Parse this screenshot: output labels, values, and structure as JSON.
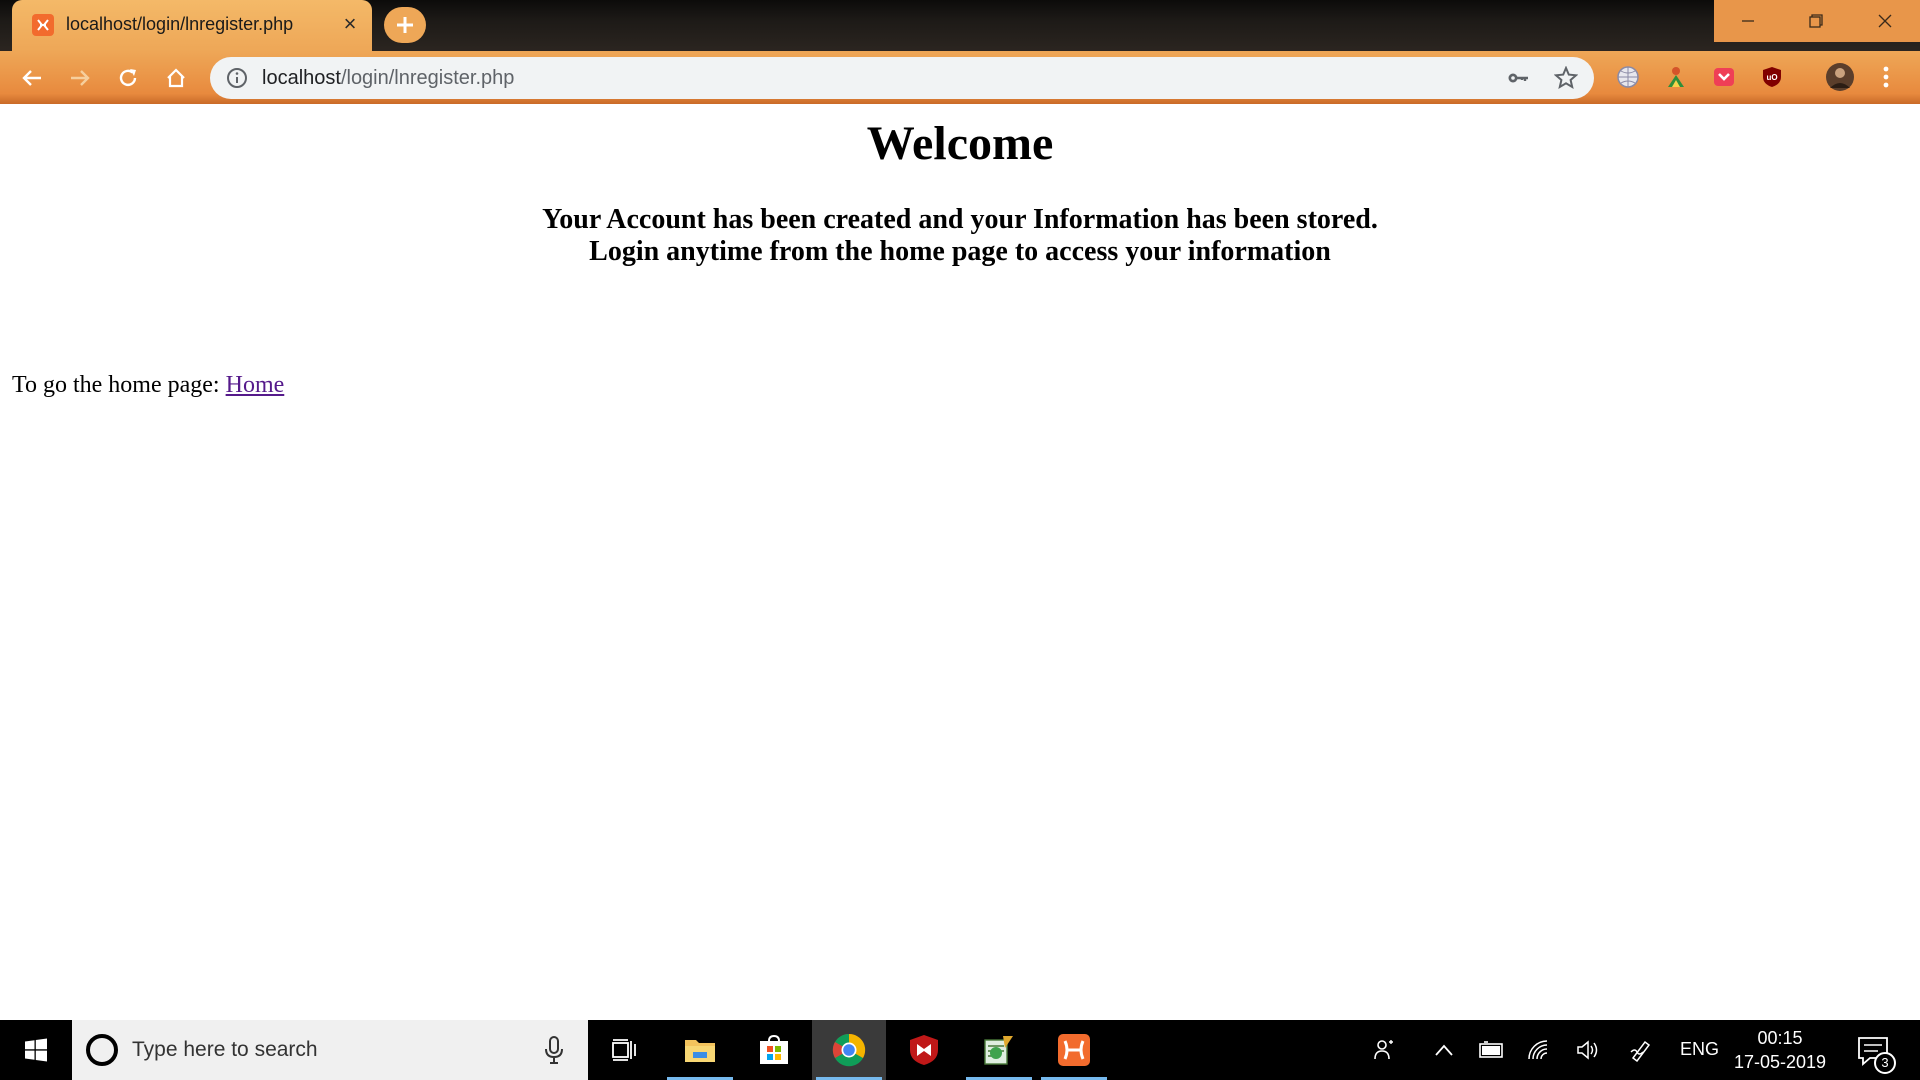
{
  "browser": {
    "tab": {
      "title": "localhost/login/lnregister.php",
      "close": "×"
    },
    "address_bar": {
      "host": "localhost",
      "path": "/login/lnregister.php"
    },
    "extensions": [
      "globe-extension-icon",
      "person-extension-icon",
      "pocket-icon",
      "ublock-icon"
    ],
    "colors": {
      "accent": "#eea757",
      "toolbar": "#e88a3e"
    }
  },
  "page": {
    "heading": "Welcome",
    "message_line1": "Your Account has been created and your Information has been stored.",
    "message_line2": "Login anytime from the home page to access your information",
    "home_prefix": "To go the home page: ",
    "home_link": "Home"
  },
  "taskbar": {
    "search_placeholder": "Type here to search",
    "apps": [
      "task-view-icon",
      "file-explorer-icon",
      "store-icon",
      "chrome-icon",
      "mcafee-icon",
      "notepad-app-icon",
      "xampp-icon"
    ],
    "language": "ENG",
    "time": "00:15",
    "date": "17-05-2019",
    "notification_count": "3"
  }
}
